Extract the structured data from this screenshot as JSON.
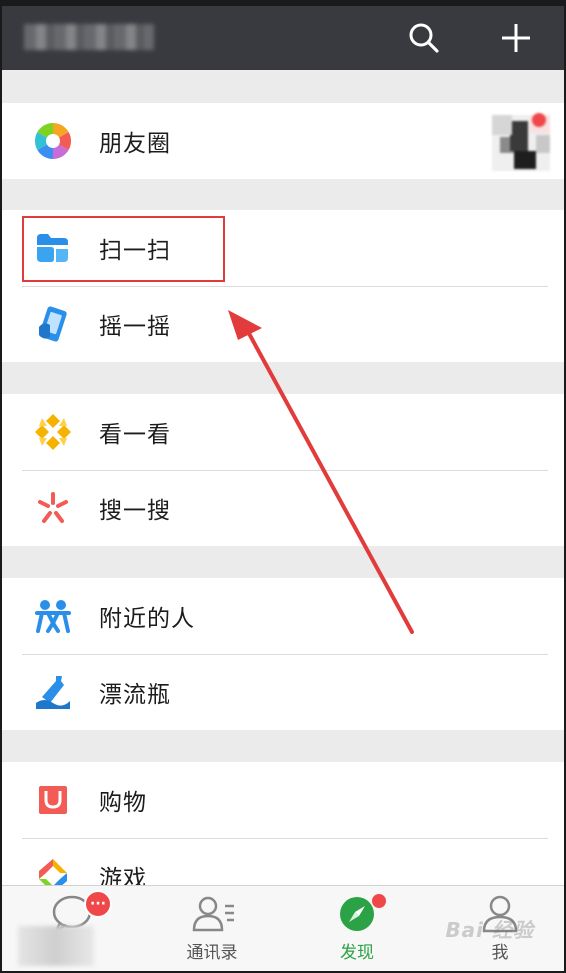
{
  "header": {
    "search_icon": "search-icon",
    "add_icon": "plus-icon"
  },
  "discover": {
    "groups": [
      {
        "items": [
          {
            "label": "朋友圈",
            "icon": "moments-icon"
          }
        ]
      },
      {
        "items": [
          {
            "label": "扫一扫",
            "icon": "scan-icon"
          },
          {
            "label": "摇一摇",
            "icon": "shake-icon"
          }
        ]
      },
      {
        "items": [
          {
            "label": "看一看",
            "icon": "top-stories-icon"
          },
          {
            "label": "搜一搜",
            "icon": "search-search-icon"
          }
        ]
      },
      {
        "items": [
          {
            "label": "附近的人",
            "icon": "people-nearby-icon"
          },
          {
            "label": "漂流瓶",
            "icon": "drift-bottle-icon"
          }
        ]
      },
      {
        "items": [
          {
            "label": "购物",
            "icon": "shopping-icon"
          },
          {
            "label": "游戏",
            "icon": "games-icon"
          }
        ]
      }
    ]
  },
  "tabbar": {
    "tabs": [
      {
        "label": "",
        "icon": "chats-icon",
        "badge": "···"
      },
      {
        "label": "通讯录",
        "icon": "contacts-icon"
      },
      {
        "label": "发现",
        "icon": "discover-icon",
        "active": true
      },
      {
        "label": "我",
        "icon": "me-icon"
      }
    ]
  },
  "watermark": "Bai 经验",
  "colors": {
    "header_bg": "#393a3f",
    "accent_green": "#2ba245",
    "badge_red": "#f04848",
    "annotation_red": "#e23b3b"
  }
}
